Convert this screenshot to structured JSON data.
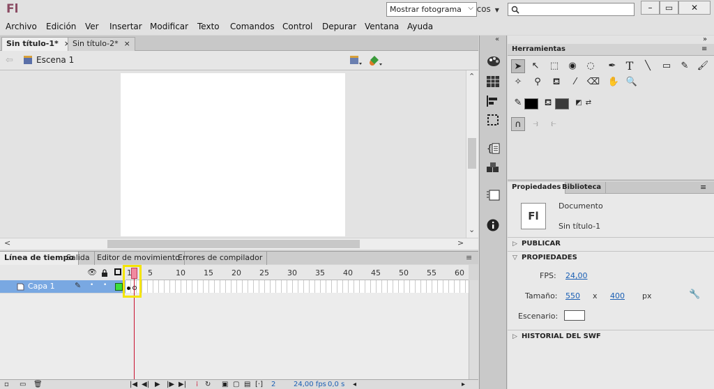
{
  "app": {
    "logo_text": "Fl",
    "workspace": "Conceptos básicos"
  },
  "window": {
    "minimize": "–",
    "restore": "▭",
    "close": "✕"
  },
  "menu": [
    "Archivo",
    "Edición",
    "Ver",
    "Insertar",
    "Modificar",
    "Texto",
    "Comandos",
    "Control",
    "Depurar",
    "Ventana",
    "Ayuda"
  ],
  "doc_tabs": [
    {
      "label": "Sin título-1*",
      "close": "×",
      "active": true
    },
    {
      "label": "Sin título-2*",
      "close": "×",
      "active": false
    }
  ],
  "scene": {
    "label": "Escena 1",
    "view_select": "Mostrar fotograma"
  },
  "timeline": {
    "tabs": [
      "Línea de tiempo",
      "Salida",
      "Editor de movimiento",
      "Errores de compilador"
    ],
    "frame_numbers": [
      "1",
      "5",
      "10",
      "15",
      "20",
      "25",
      "30",
      "35",
      "40",
      "45",
      "50",
      "55",
      "60"
    ],
    "layer_name": "Capa 1",
    "current_frame": "2",
    "fps": "24,00 fps",
    "time": "0,0 s"
  },
  "tools_panel": {
    "title": "Herramientas"
  },
  "properties": {
    "tabs": [
      "Propiedades",
      "Biblioteca"
    ],
    "doc_icon_text": "Fl",
    "doc_type": "Documento",
    "doc_name": "Sin título-1",
    "sections": {
      "publish": "PUBLICAR",
      "properties": "PROPIEDADES",
      "swf_history": "HISTORIAL DEL SWF"
    },
    "fps_label": "FPS:",
    "fps_value": "24,00",
    "size_label": "Tamaño:",
    "width": "550",
    "x": "x",
    "height": "400",
    "unit": "px",
    "stage_label": "Escenario:"
  },
  "colors": {
    "stage": "#ffffff",
    "layer_selected": "#79a8e2",
    "playhead": "#c8102e",
    "highlight": "#f4e400"
  }
}
